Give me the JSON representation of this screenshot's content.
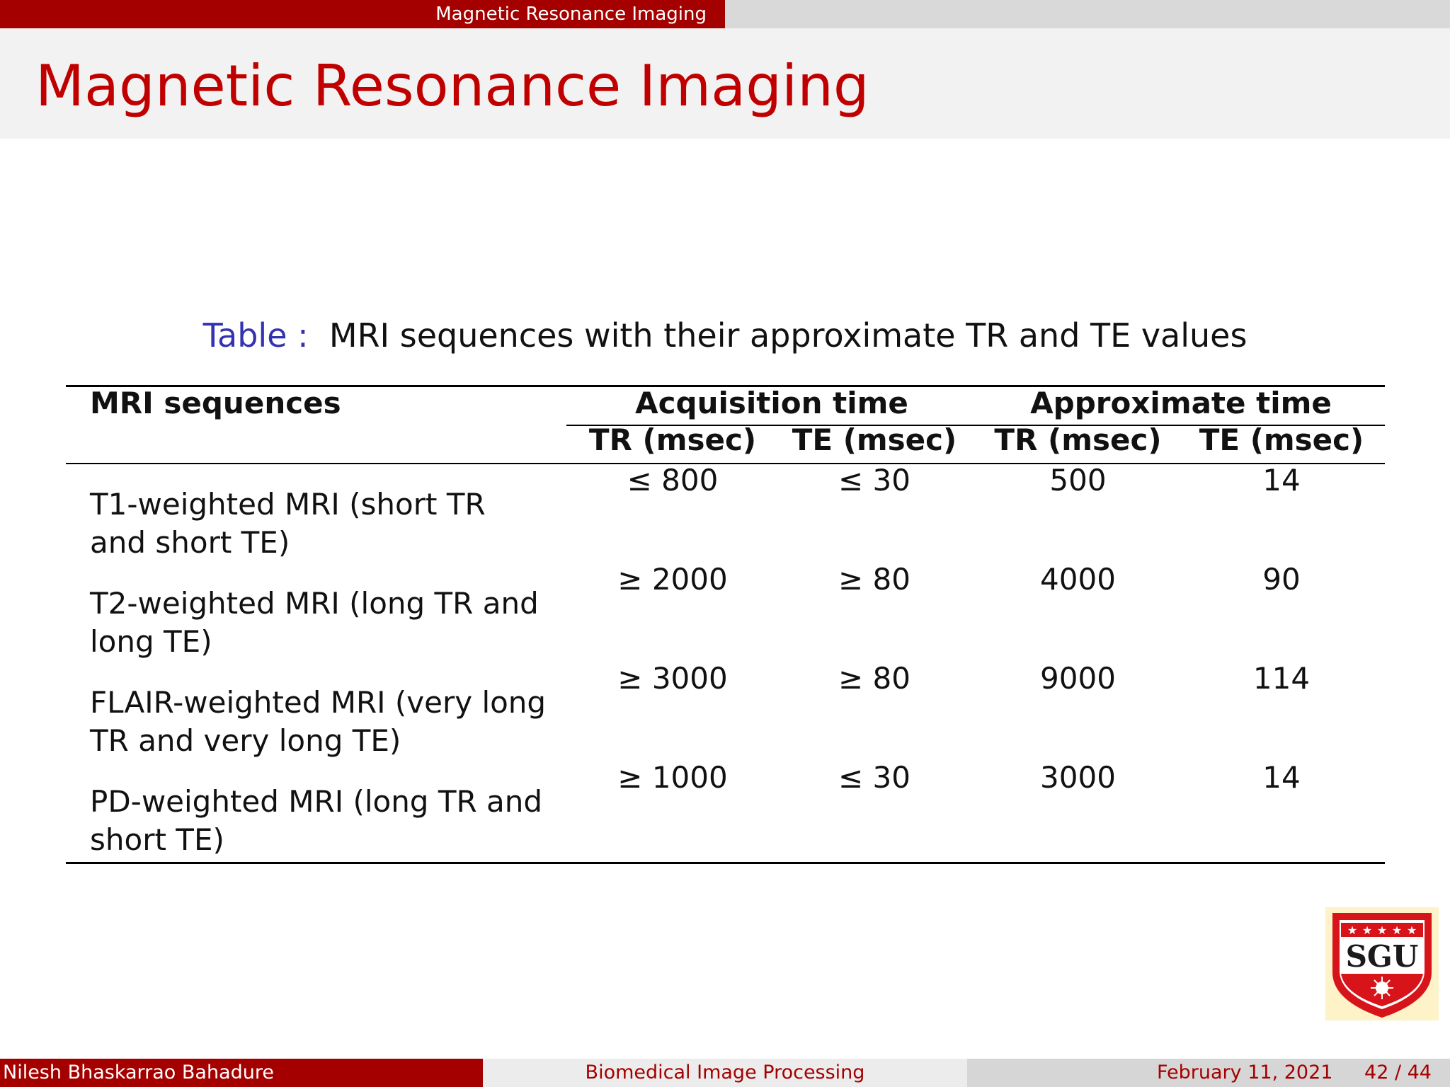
{
  "header": {
    "section": "Magnetic Resonance Imaging",
    "title": "Magnetic Resonance Imaging"
  },
  "caption": {
    "label": "Table",
    "separator": ":",
    "text": "MRI sequences with their approximate TR and TE values"
  },
  "table": {
    "col0_header": "MRI sequences",
    "group1": "Acquisition time",
    "group2": "Approximate time",
    "subheaders": [
      "TR (msec)",
      "TE (msec)",
      "TR (msec)",
      "TE (msec)"
    ],
    "rows": [
      {
        "label": "T1-weighted MRI (short TR and short TE)",
        "values": [
          "≤ 800",
          "≤ 30",
          "500",
          "14"
        ]
      },
      {
        "label": "T2-weighted MRI (long TR and long TE)",
        "values": [
          "≥ 2000",
          "≥ 80",
          "4000",
          "90"
        ]
      },
      {
        "label": "FLAIR-weighted MRI (very long TR and very long TE)",
        "values": [
          "≥ 3000",
          "≥ 80",
          "9000",
          "114"
        ]
      },
      {
        "label": "PD-weighted MRI (long TR and short TE)",
        "values": [
          "≥ 1000",
          "≤ 30",
          "3000",
          "14"
        ]
      }
    ]
  },
  "logo": {
    "text": "SGU",
    "colors": {
      "red": "#d7141a",
      "cream": "#fdf2c8"
    }
  },
  "footer": {
    "author": "Nilesh Bhaskarrao Bahadure",
    "course": "Biomedical Image Processing",
    "date": "February 11, 2021",
    "page": "42 / 44"
  },
  "colors": {
    "accent": "#a50000",
    "title": "#c00000",
    "caption_label": "#3333b2"
  }
}
